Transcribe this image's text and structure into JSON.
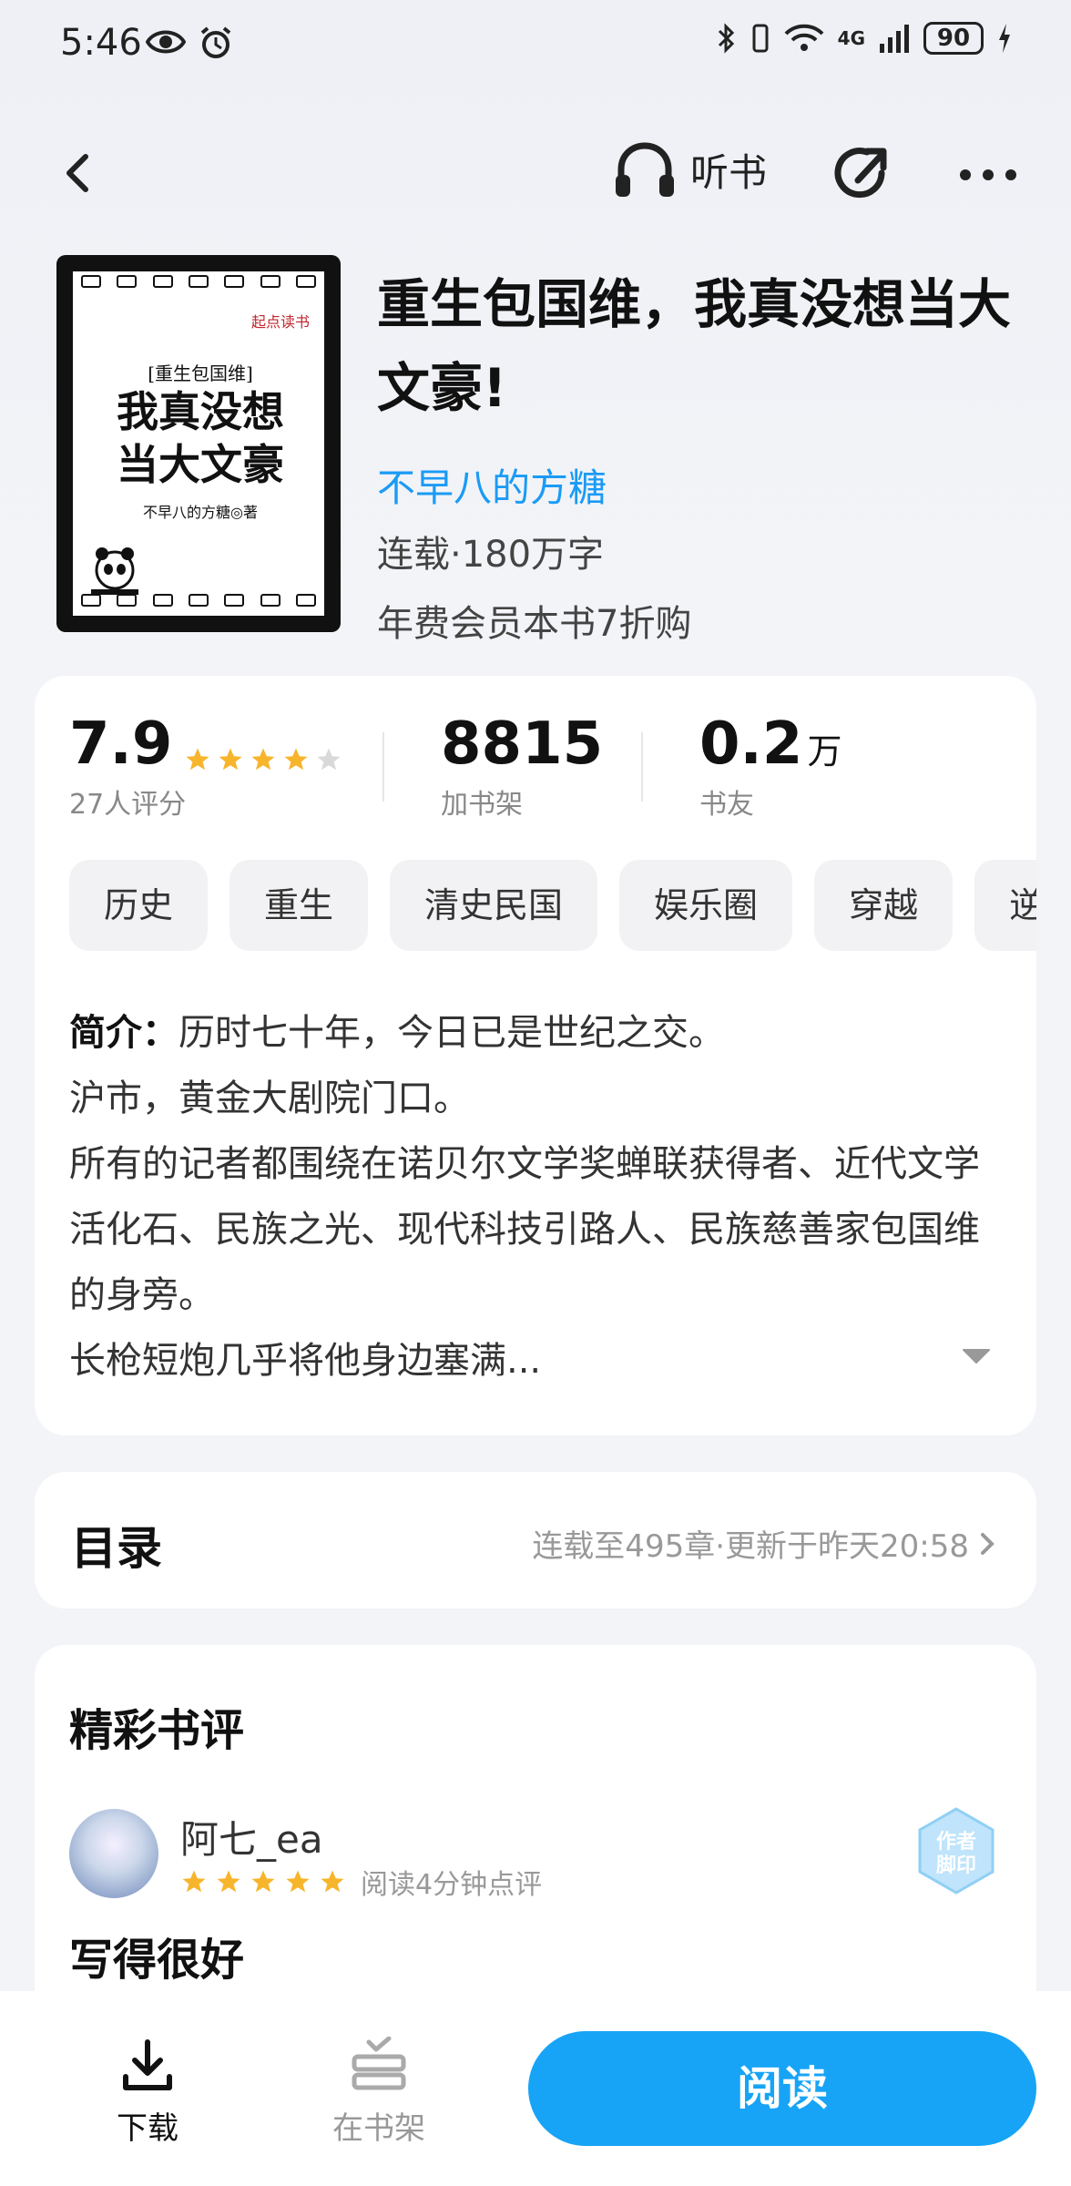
{
  "status_bar": {
    "time": "5:46",
    "network": "4G",
    "battery": "90"
  },
  "nav": {
    "listen_label": "听书"
  },
  "cover": {
    "brand": "起点读书",
    "subtitle": "[重生包国维]",
    "line1": "我真没想",
    "line2": "当大文豪",
    "author": "不早八的方糖◎著"
  },
  "book": {
    "title": "重生包国维，我真没想当大文豪!",
    "author": "不早八的方糖",
    "status": "连载·180万字",
    "vip_offer": "年费会员本书7折购"
  },
  "stats": {
    "rating": "7.9",
    "rating_stars": 4,
    "rating_label": "27人评分",
    "shelf_count": "8815",
    "shelf_label": "加书架",
    "fans_count": "0.2",
    "fans_unit": "万",
    "fans_label": "书友"
  },
  "tags": [
    "历史",
    "重生",
    "清史民国",
    "娱乐圈",
    "穿越",
    "逆"
  ],
  "intro": {
    "label": "简介：",
    "line1": "历时七十年，今日已是世纪之交。",
    "line2": "沪市，黄金大剧院门口。",
    "line3": "所有的记者都围绕在诺贝尔文学奖蝉联获得者、近代文学活化石、民族之光、现代科技引路人、民族慈善家包国维的身旁。",
    "line4": "长枪短炮几乎将他身边塞满..."
  },
  "toc": {
    "title": "目录",
    "meta": "连载至495章·更新于昨天20:58"
  },
  "reviews": {
    "title": "精彩书评",
    "items": [
      {
        "user": "阿七_ea",
        "stars": 5,
        "note": "阅读4分钟点评",
        "badge": "作者脚印",
        "text": "写得很好"
      }
    ]
  },
  "bottom": {
    "download_label": "下载",
    "shelf_label": "在书架",
    "read_label": "阅读"
  },
  "colors": {
    "accent": "#17a4f6",
    "author_link": "#1a9bf5",
    "star": "#f7b52c",
    "star_empty": "#d9d9d9"
  }
}
